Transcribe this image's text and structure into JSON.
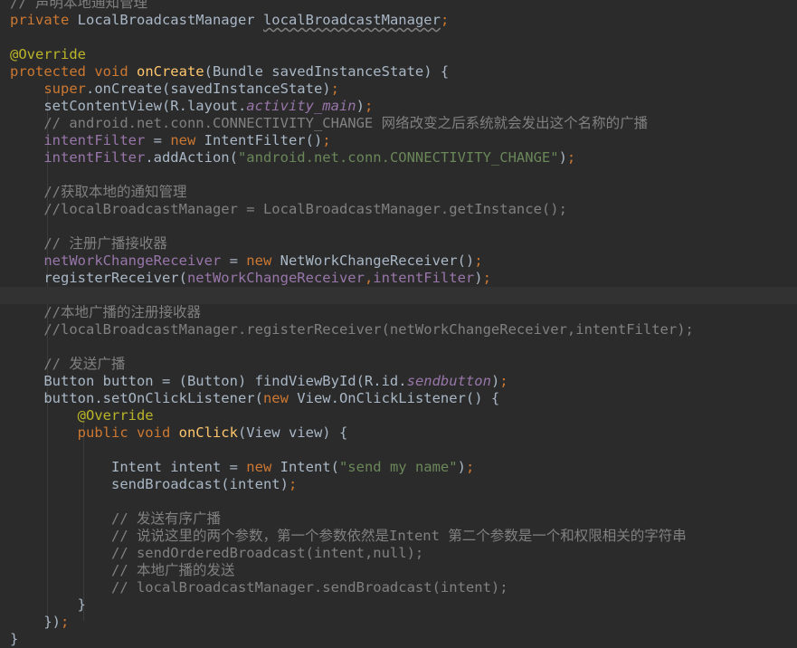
{
  "code_lines": [
    {
      "line": 1,
      "tokens": [
        {
          "t": "// 声明本地通知管理",
          "c": "tok-comment"
        }
      ]
    },
    {
      "line": 2,
      "tokens": [
        {
          "t": "private ",
          "c": "tok-keyword"
        },
        {
          "t": "LocalBroadcastManager ",
          "c": "tok-plain"
        },
        {
          "t": "localBroadcastManager",
          "c": "tok-unused"
        },
        {
          "t": ";",
          "c": "tok-keyword"
        }
      ]
    },
    {
      "line": 3,
      "tokens": []
    },
    {
      "line": 4,
      "tokens": [
        {
          "t": "@Override",
          "c": "tok-annotation"
        }
      ]
    },
    {
      "line": 5,
      "tokens": [
        {
          "t": "protected void ",
          "c": "tok-keyword"
        },
        {
          "t": "onCreate",
          "c": "tok-method"
        },
        {
          "t": "(Bundle savedInstanceState) {",
          "c": "tok-plain"
        }
      ]
    },
    {
      "line": 6,
      "tokens": [
        {
          "t": "    ",
          "c": "tok-plain"
        },
        {
          "t": "super",
          "c": "tok-keyword"
        },
        {
          "t": ".onCreate(savedInstanceState)",
          "c": "tok-plain"
        },
        {
          "t": ";",
          "c": "tok-keyword"
        }
      ]
    },
    {
      "line": 7,
      "tokens": [
        {
          "t": "    setContentView(R.layout.",
          "c": "tok-plain"
        },
        {
          "t": "activity_main",
          "c": "tok-field-italic"
        },
        {
          "t": ")",
          "c": "tok-plain"
        },
        {
          "t": ";",
          "c": "tok-keyword"
        }
      ]
    },
    {
      "line": 8,
      "tokens": [
        {
          "t": "    ",
          "c": "tok-plain"
        },
        {
          "t": "// android.net.conn.CONNECTIVITY_CHANGE 网络改变之后系统就会发出这个名称的广播",
          "c": "tok-comment"
        }
      ]
    },
    {
      "line": 9,
      "tokens": [
        {
          "t": "    ",
          "c": "tok-plain"
        },
        {
          "t": "intentFilter",
          "c": "tok-field"
        },
        {
          "t": " = ",
          "c": "tok-plain"
        },
        {
          "t": "new ",
          "c": "tok-keyword"
        },
        {
          "t": "IntentFilter()",
          "c": "tok-plain"
        },
        {
          "t": ";",
          "c": "tok-keyword"
        }
      ]
    },
    {
      "line": 10,
      "tokens": [
        {
          "t": "    ",
          "c": "tok-plain"
        },
        {
          "t": "intentFilter",
          "c": "tok-field"
        },
        {
          "t": ".addAction(",
          "c": "tok-plain"
        },
        {
          "t": "\"android.net.conn.CONNECTIVITY_CHANGE\"",
          "c": "tok-string"
        },
        {
          "t": ")",
          "c": "tok-plain"
        },
        {
          "t": ";",
          "c": "tok-keyword"
        }
      ]
    },
    {
      "line": 11,
      "tokens": []
    },
    {
      "line": 12,
      "tokens": [
        {
          "t": "    ",
          "c": "tok-plain"
        },
        {
          "t": "//获取本地的通知管理",
          "c": "tok-comment"
        }
      ]
    },
    {
      "line": 13,
      "tokens": [
        {
          "t": "    ",
          "c": "tok-plain"
        },
        {
          "t": "//localBroadcastManager = LocalBroadcastManager.getInstance();",
          "c": "tok-comment"
        }
      ]
    },
    {
      "line": 14,
      "tokens": []
    },
    {
      "line": 15,
      "tokens": [
        {
          "t": "    ",
          "c": "tok-plain"
        },
        {
          "t": "// 注册广播接收器",
          "c": "tok-comment"
        }
      ]
    },
    {
      "line": 16,
      "tokens": [
        {
          "t": "    ",
          "c": "tok-plain"
        },
        {
          "t": "netWorkChangeReceiver",
          "c": "tok-field"
        },
        {
          "t": " = ",
          "c": "tok-plain"
        },
        {
          "t": "new ",
          "c": "tok-keyword"
        },
        {
          "t": "NetWorkChangeReceiver()",
          "c": "tok-plain"
        },
        {
          "t": ";",
          "c": "tok-keyword"
        }
      ]
    },
    {
      "line": 17,
      "tokens": [
        {
          "t": "    registerReceiver(",
          "c": "tok-plain"
        },
        {
          "t": "netWorkChangeReceiver",
          "c": "tok-field"
        },
        {
          "t": ",",
          "c": "tok-keyword"
        },
        {
          "t": "intentFilter",
          "c": "tok-field"
        },
        {
          "t": ")",
          "c": "tok-plain"
        },
        {
          "t": ";",
          "c": "tok-keyword"
        }
      ]
    },
    {
      "line": 18,
      "tokens": [],
      "current": true
    },
    {
      "line": 19,
      "tokens": [
        {
          "t": "    ",
          "c": "tok-plain"
        },
        {
          "t": "//本地广播的注册接收器",
          "c": "tok-comment"
        }
      ]
    },
    {
      "line": 20,
      "tokens": [
        {
          "t": "    ",
          "c": "tok-plain"
        },
        {
          "t": "//localBroadcastManager.registerReceiver(netWorkChangeReceiver,intentFilter);",
          "c": "tok-comment"
        }
      ]
    },
    {
      "line": 21,
      "tokens": []
    },
    {
      "line": 22,
      "tokens": [
        {
          "t": "    ",
          "c": "tok-plain"
        },
        {
          "t": "// 发送广播",
          "c": "tok-comment"
        }
      ]
    },
    {
      "line": 23,
      "tokens": [
        {
          "t": "    Button button = (Button) findViewById(R.id.",
          "c": "tok-plain"
        },
        {
          "t": "sendbutton",
          "c": "tok-field-italic"
        },
        {
          "t": ")",
          "c": "tok-plain"
        },
        {
          "t": ";",
          "c": "tok-keyword"
        }
      ]
    },
    {
      "line": 24,
      "tokens": [
        {
          "t": "    button.setOnClickListener(",
          "c": "tok-plain"
        },
        {
          "t": "new ",
          "c": "tok-keyword"
        },
        {
          "t": "View.OnClickListener() {",
          "c": "tok-plain"
        }
      ]
    },
    {
      "line": 25,
      "tokens": [
        {
          "t": "        ",
          "c": "tok-plain"
        },
        {
          "t": "@Override",
          "c": "tok-annotation"
        }
      ]
    },
    {
      "line": 26,
      "tokens": [
        {
          "t": "        ",
          "c": "tok-plain"
        },
        {
          "t": "public void ",
          "c": "tok-keyword"
        },
        {
          "t": "onClick",
          "c": "tok-method"
        },
        {
          "t": "(View view) {",
          "c": "tok-plain"
        }
      ]
    },
    {
      "line": 27,
      "tokens": []
    },
    {
      "line": 28,
      "tokens": [
        {
          "t": "            Intent intent = ",
          "c": "tok-plain"
        },
        {
          "t": "new ",
          "c": "tok-keyword"
        },
        {
          "t": "Intent(",
          "c": "tok-plain"
        },
        {
          "t": "\"send my name\"",
          "c": "tok-string"
        },
        {
          "t": ")",
          "c": "tok-plain"
        },
        {
          "t": ";",
          "c": "tok-keyword"
        }
      ]
    },
    {
      "line": 29,
      "tokens": [
        {
          "t": "            sendBroadcast(intent)",
          "c": "tok-plain"
        },
        {
          "t": ";",
          "c": "tok-keyword"
        }
      ]
    },
    {
      "line": 30,
      "tokens": []
    },
    {
      "line": 31,
      "tokens": [
        {
          "t": "            ",
          "c": "tok-plain"
        },
        {
          "t": "// 发送有序广播",
          "c": "tok-comment"
        }
      ]
    },
    {
      "line": 32,
      "tokens": [
        {
          "t": "            ",
          "c": "tok-plain"
        },
        {
          "t": "// 说说这里的两个参数，第一个参数依然是Intent 第二个参数是一个和权限相关的字符串",
          "c": "tok-comment"
        }
      ]
    },
    {
      "line": 33,
      "tokens": [
        {
          "t": "            ",
          "c": "tok-plain"
        },
        {
          "t": "// sendOrderedBroadcast(intent,null);",
          "c": "tok-comment"
        }
      ]
    },
    {
      "line": 34,
      "tokens": [
        {
          "t": "            ",
          "c": "tok-plain"
        },
        {
          "t": "// 本地广播的发送",
          "c": "tok-comment"
        }
      ]
    },
    {
      "line": 35,
      "tokens": [
        {
          "t": "            ",
          "c": "tok-plain"
        },
        {
          "t": "// localBroadcastManager.sendBroadcast(intent);",
          "c": "tok-comment"
        }
      ]
    },
    {
      "line": 36,
      "tokens": [
        {
          "t": "        }",
          "c": "tok-plain"
        }
      ]
    },
    {
      "line": 37,
      "tokens": [
        {
          "t": "    })",
          "c": "tok-plain"
        },
        {
          "t": ";",
          "c": "tok-keyword"
        }
      ]
    },
    {
      "line": 38,
      "tokens": [
        {
          "t": "}",
          "c": "tok-plain"
        }
      ]
    }
  ],
  "theme": {
    "background": "#2b2b2b",
    "current_line": "#323232",
    "keyword": "#cc7832",
    "comment": "#808080",
    "annotation": "#bbb529",
    "method": "#ffc66d",
    "field": "#9876aa",
    "string": "#6a8759",
    "plain": "#a9b7c6"
  }
}
